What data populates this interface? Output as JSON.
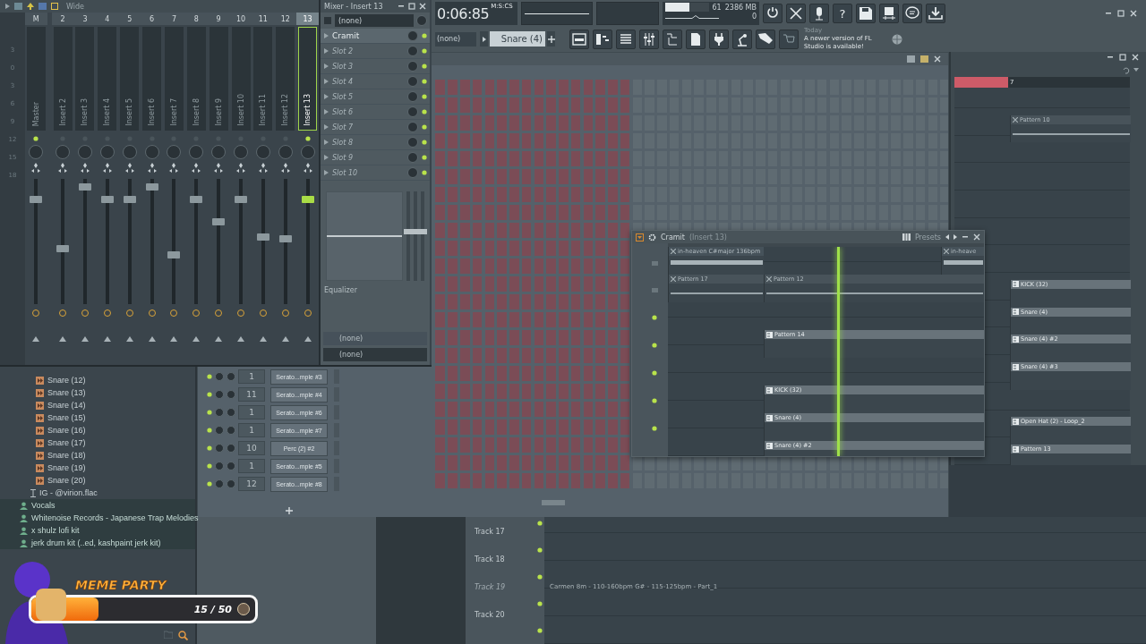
{
  "mixer": {
    "title": "Wide",
    "scale": [
      "3",
      "0",
      "3",
      "6",
      "9",
      "12",
      "15",
      "18"
    ],
    "strips": [
      {
        "number": "M",
        "name": "Master",
        "lit": true,
        "selected": false,
        "level": 0.86
      },
      {
        "number": "2",
        "name": "Insert 2",
        "lit": false,
        "selected": false,
        "level": 0.44
      },
      {
        "number": "3",
        "name": "Insert 3",
        "lit": false,
        "selected": false,
        "level": 0.96
      },
      {
        "number": "4",
        "name": "Insert 4",
        "lit": false,
        "selected": false,
        "level": 0.86
      },
      {
        "number": "5",
        "name": "Insert 5",
        "lit": false,
        "selected": false,
        "level": 0.86
      },
      {
        "number": "6",
        "name": "Insert 6",
        "lit": false,
        "selected": false,
        "level": 0.96
      },
      {
        "number": "7",
        "name": "Insert 7",
        "lit": false,
        "selected": false,
        "level": 0.39
      },
      {
        "number": "8",
        "name": "Insert 8",
        "lit": false,
        "selected": false,
        "level": 0.86
      },
      {
        "number": "9",
        "name": "Insert 9",
        "lit": false,
        "selected": false,
        "level": 0.67
      },
      {
        "number": "10",
        "name": "Insert 10",
        "lit": false,
        "selected": false,
        "level": 0.86
      },
      {
        "number": "11",
        "name": "Insert 11",
        "lit": false,
        "selected": false,
        "level": 0.54
      },
      {
        "number": "12",
        "name": "Insert 12",
        "lit": false,
        "selected": false,
        "level": 0.52
      },
      {
        "number": "13",
        "name": "Insert 13",
        "lit": true,
        "selected": true,
        "level": 0.86
      }
    ]
  },
  "insert_panel": {
    "title": "Mixer - Insert 13",
    "input": "(none)",
    "slots": [
      {
        "name": "Cramit",
        "active": true
      },
      {
        "name": "Slot 2",
        "active": false
      },
      {
        "name": "Slot 3",
        "active": false
      },
      {
        "name": "Slot 4",
        "active": false
      },
      {
        "name": "Slot 5",
        "active": false
      },
      {
        "name": "Slot 6",
        "active": false
      },
      {
        "name": "Slot 7",
        "active": false
      },
      {
        "name": "Slot 8",
        "active": false
      },
      {
        "name": "Slot 9",
        "active": false
      },
      {
        "name": "Slot 10",
        "active": false
      }
    ],
    "eq_label": "Equalizer",
    "outputs": [
      "(none)",
      "(none)"
    ]
  },
  "toolbar": {
    "time": "0:06:85",
    "time_format": "M:S:CS",
    "cpu": "61",
    "cpu_meter": {
      "level": 0.55
    },
    "memory": "2386 MB",
    "polyphony": "0",
    "help": "?",
    "snap": "(none)",
    "pattern": "Snare (4)",
    "news_day": "Today",
    "news": "A newer version of FL Studio is available!"
  },
  "channel_rack": {
    "channels": [
      {
        "number": "1",
        "name": "Serato...mple #3"
      },
      {
        "number": "11",
        "name": "Serato...mple #4"
      },
      {
        "number": "1",
        "name": "Serato...mple #6"
      },
      {
        "number": "1",
        "name": "Serato...mple #7"
      },
      {
        "number": "10",
        "name": "Perc (2) #2"
      },
      {
        "number": "1",
        "name": "Serato...mple #5"
      },
      {
        "number": "12",
        "name": "Serato...mple #8"
      }
    ]
  },
  "browser": {
    "items": [
      {
        "kind": "sample",
        "name": "Snare (12)"
      },
      {
        "kind": "sample",
        "name": "Snare (13)"
      },
      {
        "kind": "sample",
        "name": "Snare (14)"
      },
      {
        "kind": "sample",
        "name": "Snare (15)"
      },
      {
        "kind": "sample",
        "name": "Snare (16)"
      },
      {
        "kind": "sample",
        "name": "Snare (17)"
      },
      {
        "kind": "sample",
        "name": "Snare (18)"
      },
      {
        "kind": "sample",
        "name": "Snare (19)"
      },
      {
        "kind": "sample",
        "name": "Snare (20)"
      },
      {
        "kind": "file",
        "name": "IG - @virion.flac"
      },
      {
        "kind": "folder",
        "name": "Vocals"
      },
      {
        "kind": "folder",
        "name": "Whitenoise Records - Japanese Trap Melodies"
      },
      {
        "kind": "folder",
        "name": "x shulz lofi kit"
      },
      {
        "kind": "folder",
        "name": "jerk drum kit (..ed, kashpaint jerk kit)"
      }
    ]
  },
  "overlay": {
    "title": "MEME PARTY",
    "count": "15 / 50",
    "level": 0.3
  },
  "plugin_window": {
    "title": "Cramit",
    "subtitle": "(Insert 13)",
    "presets": "Presets",
    "clips": [
      {
        "name": "in-heaven C#major 136bpm",
        "kind": "audio"
      },
      {
        "name": "in-heave",
        "kind": "audio"
      },
      {
        "name": "Pattern 17",
        "kind": "automation"
      },
      {
        "name": "Pattern 12",
        "kind": "automation"
      },
      {
        "name": "Pattern 14",
        "kind": "pattern"
      },
      {
        "name": "KICK (32)",
        "kind": "pattern"
      },
      {
        "name": "Snare (4)",
        "kind": "pattern"
      },
      {
        "name": "Snare (4) #2",
        "kind": "pattern"
      }
    ]
  },
  "playlist": {
    "marker": "7",
    "clips": [
      {
        "name": "Pattern 10",
        "kind": "automation"
      },
      {
        "name": "KICK (32)",
        "kind": "pattern"
      },
      {
        "name": "Snare (4)",
        "kind": "pattern"
      },
      {
        "name": "Snare (4) #2",
        "kind": "pattern"
      },
      {
        "name": "Snare (4) #3",
        "kind": "pattern"
      },
      {
        "name": "Open Hat (2) - Loop_2",
        "kind": "pattern"
      },
      {
        "name": "Pattern 13",
        "kind": "pattern"
      }
    ]
  },
  "bottom_playlist": {
    "tracks": [
      {
        "name": "Track 17",
        "dimmed": false
      },
      {
        "name": "Track 18",
        "dimmed": false
      },
      {
        "name": "Track 19",
        "dimmed": true
      },
      {
        "name": "Track 20",
        "dimmed": false
      }
    ],
    "clip": "Carmen 8m - 110-160bpm G# - 115-125bpm - Part_1"
  }
}
